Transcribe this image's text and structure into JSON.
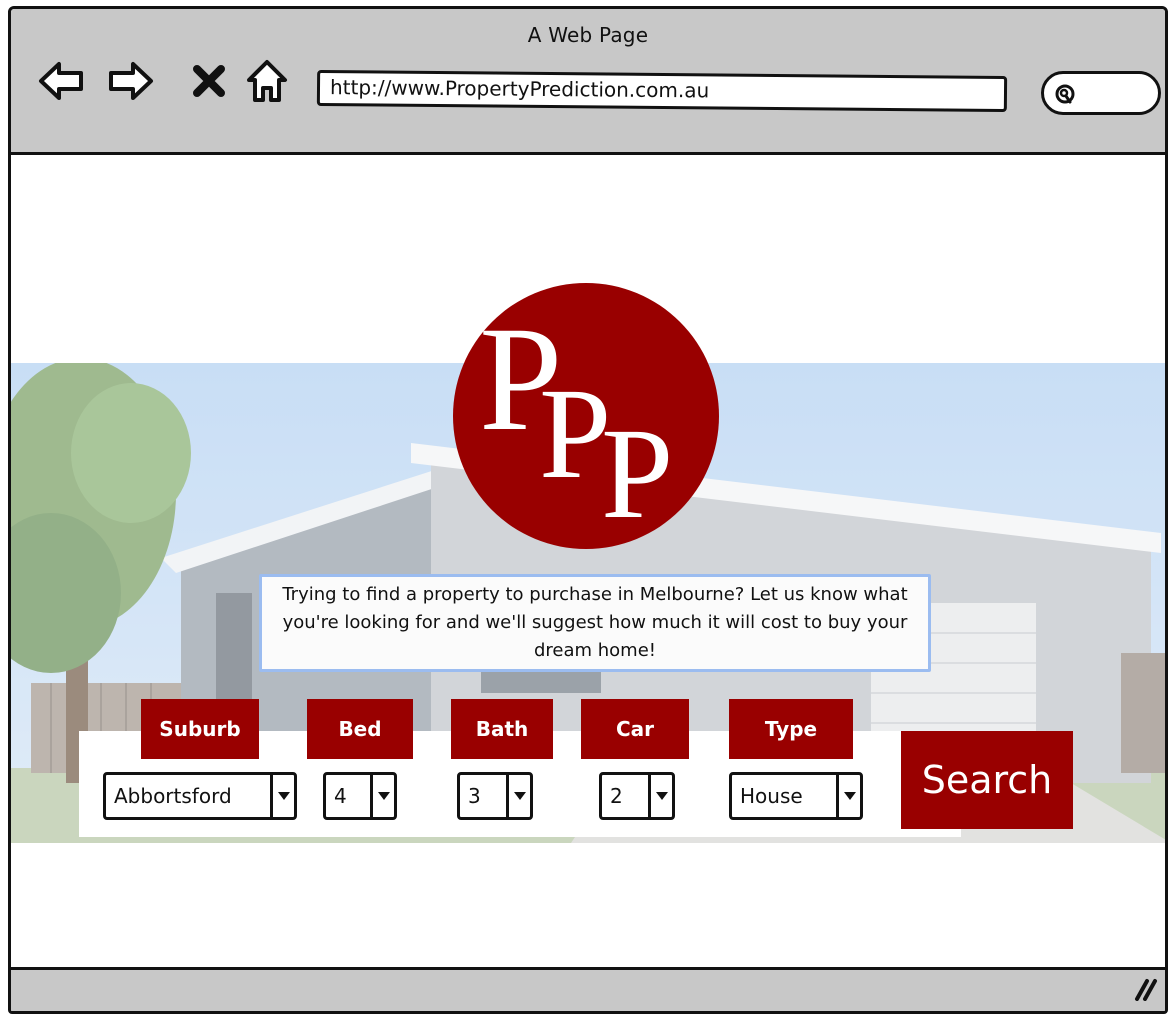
{
  "window": {
    "title": "A Web Page"
  },
  "browser": {
    "url": "http://www.PropertyPrediction.com.au",
    "nav_icons": [
      "back-arrow-icon",
      "forward-arrow-icon",
      "close-icon",
      "home-icon"
    ],
    "search_icon": "search-icon"
  },
  "logo": {
    "letters": "PPP",
    "color": "#990000"
  },
  "tagline": "Trying to find a property to purchase in Melbourne? Let us know what you're looking for and we'll suggest how much it will cost to buy your dream home!",
  "form": {
    "suburb": {
      "label": "Suburb",
      "value": "Abbortsford"
    },
    "bed": {
      "label": "Bed",
      "value": "4"
    },
    "bath": {
      "label": "Bath",
      "value": "3"
    },
    "car": {
      "label": "Car",
      "value": "2"
    },
    "type": {
      "label": "Type",
      "value": "House"
    }
  },
  "search_button": "Search",
  "colors": {
    "accent": "#990000",
    "chrome": "#c8c8c8",
    "tagline_border": "#9bbcf0"
  }
}
